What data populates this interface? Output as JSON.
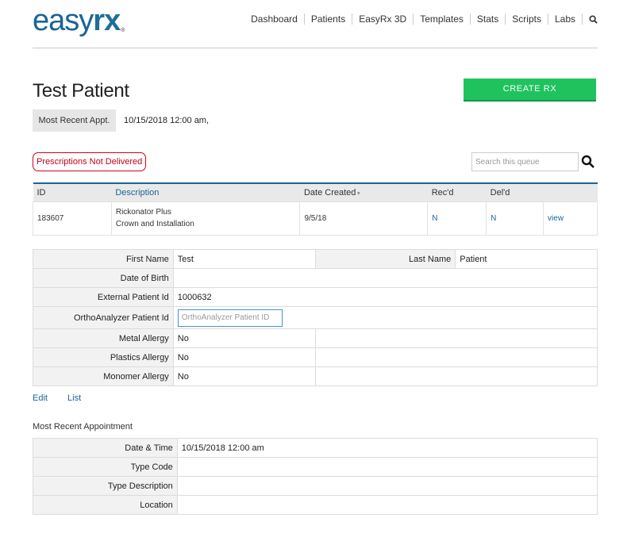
{
  "header": {
    "logo_easy": "easy",
    "logo_rx": "rx",
    "logo_mark": "®",
    "nav": [
      "Dashboard",
      "Patients",
      "EasyRx 3D",
      "Templates",
      "Stats",
      "Scripts",
      "Labs"
    ],
    "search_icon": "search-icon"
  },
  "page": {
    "title": "Test Patient",
    "create_button": "CREATE RX",
    "appt_label": "Most Recent Appt.",
    "appt_value": "10/15/2018 12:00 am,"
  },
  "queue": {
    "filter_badge": "Prescriptions Not Delivered",
    "search_placeholder": "Search this queue",
    "columns": [
      "ID",
      "Description",
      "Date Created",
      "Rec'd",
      "Del'd",
      ""
    ],
    "rows": [
      {
        "id": "183607",
        "description_line1": "Rickonator Plus",
        "description_line2": "Crown and Installation",
        "date_created": "9/5/18",
        "recd": "N",
        "deld": "N",
        "action": "view"
      }
    ]
  },
  "patient": {
    "first_name_label": "First Name",
    "first_name": "Test",
    "last_name_label": "Last Name",
    "last_name": "Patient",
    "dob_label": "Date of Birth",
    "dob": "",
    "external_id_label": "External Patient Id",
    "external_id": "1000632",
    "ortho_label": "OrthoAnalyzer Patient Id",
    "ortho_placeholder": "OrthoAnalyzer Patient ID",
    "metal_label": "Metal Allergy",
    "metal": "No",
    "plastics_label": "Plastics Allergy",
    "plastics": "No",
    "monomer_label": "Monomer Allergy",
    "monomer": "No"
  },
  "actions": {
    "edit": "Edit",
    "list": "List"
  },
  "appointment": {
    "section_title": "Most Recent Appointment",
    "datetime_label": "Date & Time",
    "datetime": "10/15/2018 12:00 am",
    "type_code_label": "Type Code",
    "type_code": "",
    "type_desc_label": "Type Description",
    "type_desc": "",
    "location_label": "Location",
    "location": ""
  },
  "colors": {
    "brand_blue": "#1a6496",
    "create_green": "#1fc35d",
    "alert_red": "#c0021b"
  }
}
